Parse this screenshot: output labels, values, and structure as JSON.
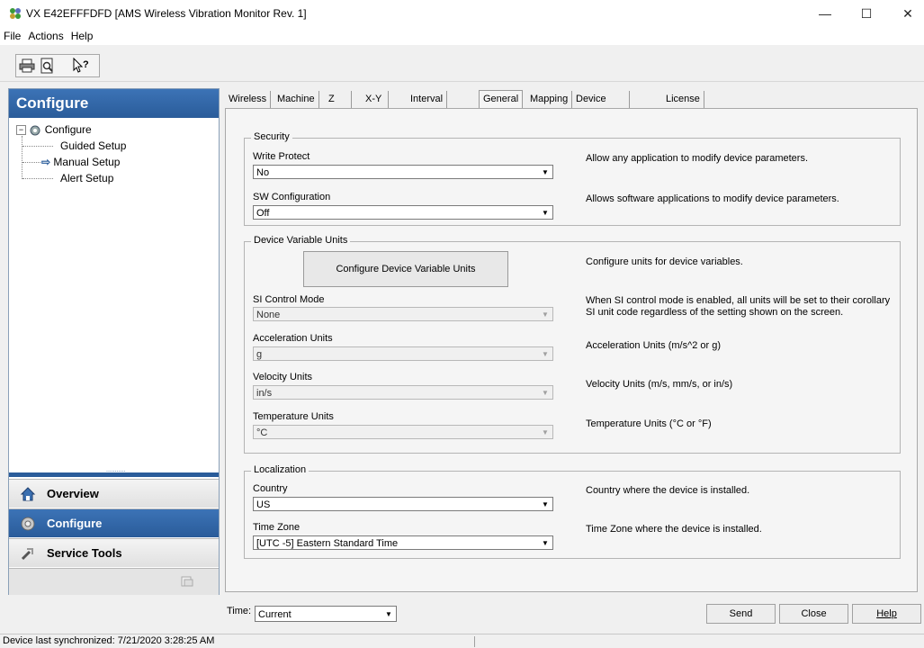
{
  "window": {
    "title": "VX E42EFFFDFD [AMS Wireless Vibration Monitor Rev. 1]",
    "minimize": "—",
    "maximize": "☐",
    "close": "✕"
  },
  "menu": [
    "File",
    "Actions",
    "Help"
  ],
  "toolbar": {
    "icons": [
      "printer-icon",
      "print-preview-icon",
      "context-help-icon"
    ]
  },
  "left": {
    "header": "Configure",
    "tree": {
      "root": "Configure",
      "items": [
        "Guided Setup",
        "Manual Setup",
        "Alert Setup"
      ],
      "selected": "Manual Setup"
    },
    "nav": [
      "Overview",
      "Configure",
      "Service Tools"
    ],
    "active_nav": "Configure",
    "splitter_dots": "..........."
  },
  "tabs": [
    "Wireless",
    "Machine",
    "Z Axis",
    "X-Y Axis",
    "Interval Bands",
    "General",
    "Mapping",
    "Device Information",
    "License"
  ],
  "active_tab": "General",
  "security": {
    "title": "Security",
    "write_protect_label": "Write Protect",
    "write_protect_value": "No",
    "write_protect_desc": "Allow any application to modify device parameters.",
    "sw_config_label": "SW Configuration",
    "sw_config_value": "Off",
    "sw_config_desc": "Allows software applications to modify device parameters."
  },
  "units": {
    "title": "Device Variable Units",
    "configure_button": "Configure Device Variable Units",
    "configure_desc": "Configure units for device variables.",
    "si_label": "SI Control Mode",
    "si_value": "None",
    "si_desc_1": "When SI control mode is enabled, all units will be set to their corollary",
    "si_desc_2": "SI unit code regardless of the setting shown on the screen.",
    "accel_label": "Acceleration Units",
    "accel_value": "g",
    "accel_desc": "Acceleration Units (m/s^2 or g)",
    "vel_label": "Velocity Units",
    "vel_value": "in/s",
    "vel_desc": "Velocity Units (m/s, mm/s, or in/s)",
    "temp_label": "Temperature Units",
    "temp_value": "°C",
    "temp_desc": "Temperature Units (°C or °F)"
  },
  "localization": {
    "title": "Localization",
    "country_label": "Country",
    "country_value": "US",
    "country_desc": "Country where the device is installed.",
    "tz_label": "Time Zone",
    "tz_value": "[UTC -5] Eastern Standard Time",
    "tz_desc": "Time Zone where the device is installed."
  },
  "bottom": {
    "time_label": "Time:",
    "time_value": "Current",
    "send": "Send",
    "close": "Close",
    "help": "Help"
  },
  "status": "Device last synchronized: 7/21/2020 3:28:25 AM"
}
